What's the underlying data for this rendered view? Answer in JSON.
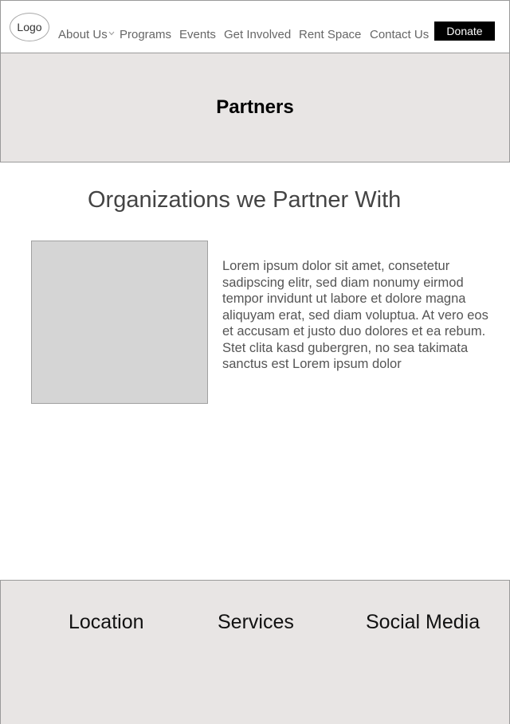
{
  "header": {
    "logo_label": "Logo",
    "nav": {
      "about": "About Us",
      "programs": "Programs",
      "events": "Events",
      "get_involved": "Get Involved",
      "rent_space": "Rent Space",
      "contact": "Contact Us"
    },
    "donate_label": "Donate"
  },
  "banner": {
    "title": "Partners"
  },
  "main": {
    "heading": "Organizations we Partner With",
    "body": "Lorem ipsum dolor sit amet, consetetur sadipscing elitr, sed diam nonumy eirmod tempor invidunt ut labore et dolore magna aliquyam erat, sed diam voluptua. At vero eos et accusam et justo duo dolores et ea rebum. Stet clita kasd gubergren, no sea takimata sanctus est Lorem ipsum dolor"
  },
  "footer": {
    "location": "Location",
    "services": "Services",
    "social_media": "Social Media"
  }
}
